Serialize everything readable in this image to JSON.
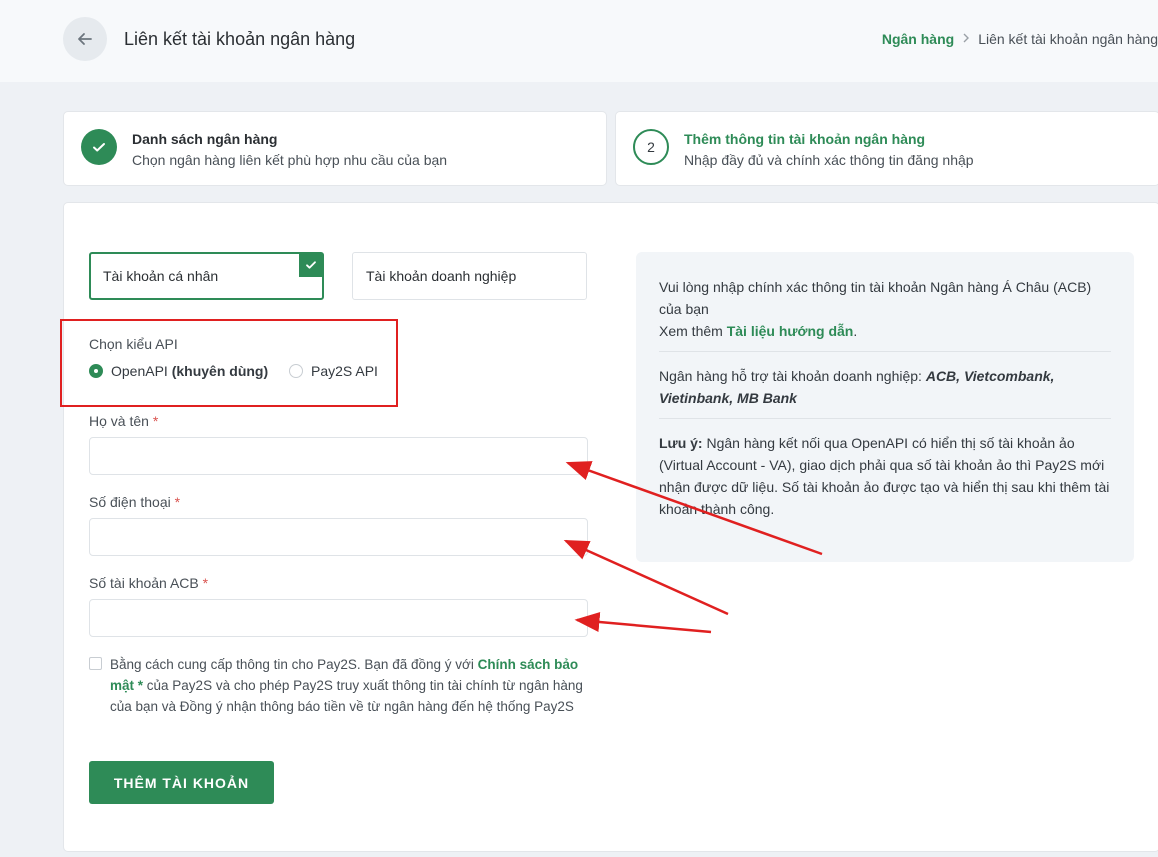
{
  "header": {
    "title": "Liên kết tài khoản ngân hàng",
    "breadcrumb": {
      "link": "Ngân hàng",
      "current": "Liên kết tài khoản ngân hàng"
    }
  },
  "steps": [
    {
      "number": "",
      "title": "Danh sách ngân hàng",
      "subtitle": "Chọn ngân hàng liên kết phù hợp nhu cầu của bạn",
      "status": "done"
    },
    {
      "number": "2",
      "title": "Thêm thông tin tài khoản ngân hàng",
      "subtitle": "Nhập đầy đủ và chính xác thông tin đăng nhập",
      "status": "active"
    }
  ],
  "account_types": {
    "personal": "Tài khoản cá nhân",
    "business": "Tài khoản doanh nghiệp",
    "selected": "personal"
  },
  "api": {
    "label": "Chọn kiểu API",
    "openapi_prefix": "OpenAPI ",
    "openapi_bold": "(khuyên dùng)",
    "pay2s": "Pay2S API",
    "selected": "openapi"
  },
  "fields": {
    "name_label": "Họ và tên",
    "phone_label": "Số điện thoại",
    "account_label": "Số tài khoản ACB",
    "required_mark": "*",
    "name_value": "",
    "phone_value": "",
    "account_value": ""
  },
  "consent": {
    "text_before": "Bằng cách cung cấp thông tin cho Pay2S. Bạn đã đồng ý với ",
    "link": "Chính sách bảo mật",
    "required_mark": " *",
    "text_after": " của Pay2S và cho phép Pay2S truy xuất thông tin tài chính từ ngân hàng của bạn và Đồng ý nhận thông báo tiền về từ ngân hàng đến hệ thống Pay2S",
    "checked": false
  },
  "submit_label": "THÊM TÀI KHOẢN",
  "info": {
    "line1": "Vui lòng nhập chính xác thông tin tài khoản Ngân hàng Á Châu (ACB) của bạn",
    "line2_prefix": "Xem thêm ",
    "line2_link": "Tài liệu hướng dẫn",
    "line2_suffix": ".",
    "banks_prefix": "Ngân hàng hỗ trợ tài khoản doanh nghiệp: ",
    "banks_list": "ACB, Vietcombank, Vietinbank, MB Bank",
    "note_label": "Lưu ý:",
    "note_text": " Ngân hàng kết nối qua OpenAPI có hiển thị số tài khoản ảo (Virtual Account - VA), giao dịch phải qua số tài khoản ảo thì Pay2S mới nhận được dữ liệu. Số tài khoản ảo được tạo và hiển thị sau khi thêm tài khoản thành công."
  },
  "colors": {
    "accent": "#2e8b57",
    "annotation": "#e02020",
    "background": "#eef1f5"
  }
}
